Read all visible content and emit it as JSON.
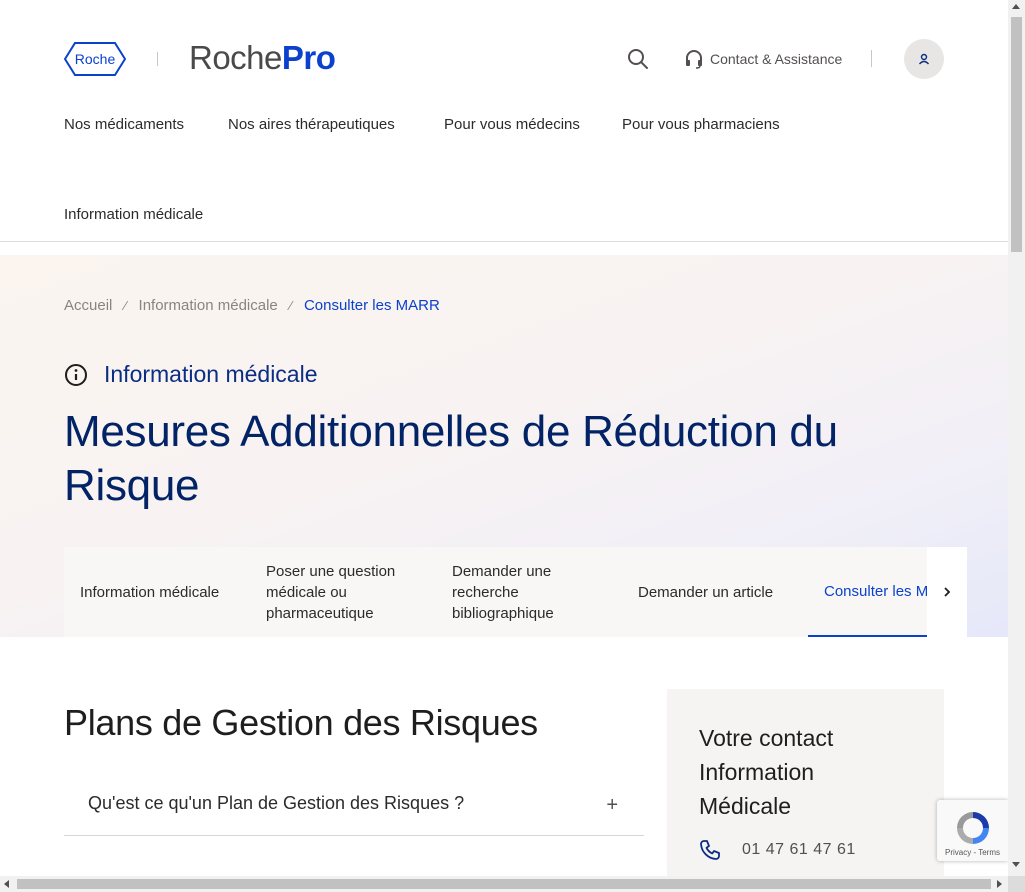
{
  "header": {
    "logo_text": "Roche",
    "brand_part1": "Roche",
    "brand_part2": "Pro",
    "contact_label": "Contact & Assistance",
    "nav_items": [
      "Nos médicaments",
      "Nos aires thérapeutiques",
      "Pour vous médecins",
      "Pour vous pharmaciens"
    ],
    "nav_item_second_row": "Information médicale"
  },
  "breadcrumb": {
    "items": [
      "Accueil",
      "Information médicale"
    ],
    "current": "Consulter les MARR",
    "separator": "⁄"
  },
  "hero": {
    "eyebrow": "Information médicale",
    "title": "Mesures Additionnelles de Réduction du Risque"
  },
  "tabs": {
    "items": [
      "Information médicale",
      "Poser une question médicale ou pharmaceutique",
      "Demander une recherche bibliographique",
      "Demander un article",
      "Consulter les MARR"
    ],
    "active_index": 4
  },
  "content": {
    "section_title": "Plans de Gestion des Risques",
    "accordion_label": "Qu'est ce qu'un Plan de Gestion des Risques ?",
    "accordion_icon": "+"
  },
  "contact_card": {
    "title": "Votre contact Information Médicale",
    "phone": "01 47 61 47 61"
  },
  "recaptcha": {
    "text": "Privacy - Terms"
  },
  "colors": {
    "brand_blue": "#0b41cd",
    "title_navy": "#022366",
    "text": "#2b2b2b"
  }
}
